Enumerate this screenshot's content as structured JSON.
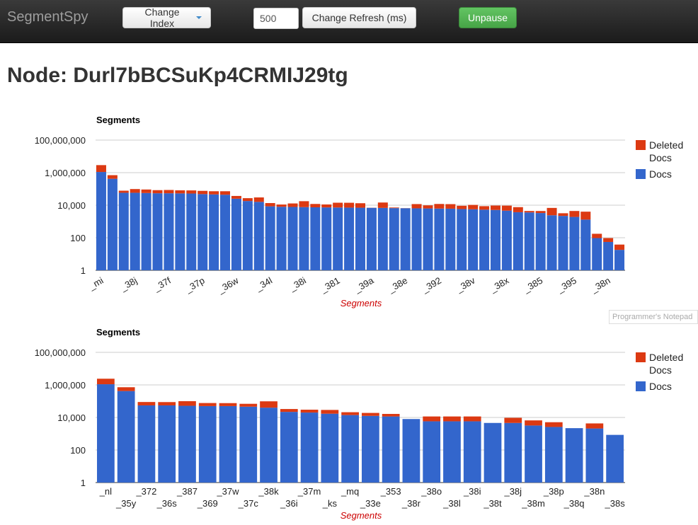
{
  "app": {
    "brand": "SegmentSpy",
    "change_index_label": "Change Index",
    "refresh_value": "500",
    "change_refresh_label": "Change Refresh (ms)",
    "unpause_label": "Unpause"
  },
  "page": {
    "title": "Node: Durl7bBCSuKp4CRMIJ29tg"
  },
  "tooltip": {
    "text": "Programmer's Notepad"
  },
  "colors": {
    "docs": "#3366cc",
    "deleted": "#dc3912",
    "axis_title": "#cc0000"
  },
  "chart_data": [
    {
      "type": "bar",
      "stacked": true,
      "log_scale": true,
      "title": "Segments",
      "xlabel": "Segments",
      "ylabel": "",
      "ylim": [
        1,
        100000000
      ],
      "y_ticks": [
        "1",
        "100",
        "10,000",
        "1,000,000",
        "100,000,000"
      ],
      "legend_position": "right",
      "legend": [
        "Deleted Docs",
        "Docs"
      ],
      "categories": [
        "_mi",
        "",
        "",
        "_38j",
        "",
        "",
        "_37f",
        "",
        "",
        "_37p",
        "",
        "",
        "_36w",
        "",
        "",
        "_34l",
        "",
        "",
        "_38i",
        "",
        "",
        "_381",
        "",
        "",
        "_39a",
        "",
        "",
        "_38e",
        "",
        "",
        "_392",
        "",
        "",
        "_38v",
        "",
        "",
        "_38x",
        "",
        "",
        "_385",
        "",
        "",
        "_395",
        "",
        "",
        "_38n",
        ""
      ],
      "series": [
        {
          "name": "Docs",
          "values": [
            1100000,
            420000,
            58000,
            58000,
            56000,
            54000,
            54000,
            53000,
            52000,
            48000,
            46000,
            44000,
            25000,
            18000,
            16000,
            8500,
            8000,
            7800,
            7600,
            7400,
            7300,
            7200,
            7100,
            7000,
            6900,
            6800,
            6600,
            6500,
            6400,
            6300,
            6200,
            6100,
            5800,
            5600,
            5300,
            5100,
            4600,
            3700,
            3600,
            3300,
            2400,
            2200,
            1900,
            1300,
            95,
            55,
            18
          ]
        },
        {
          "name": "Deleted Docs",
          "values": [
            1800000,
            280000,
            20000,
            40000,
            36000,
            30000,
            32000,
            29000,
            29000,
            28000,
            26000,
            28000,
            12000,
            9000,
            14000,
            5000,
            3000,
            5000,
            10000,
            4500,
            3800,
            7000,
            7000,
            6200,
            100,
            7800,
            600,
            100,
            5300,
            3500,
            5700,
            5500,
            3400,
            4800,
            3400,
            4400,
            4800,
            3900,
            800,
            1100,
            4400,
            1000,
            2500,
            2700,
            80,
            40,
            20
          ]
        }
      ]
    },
    {
      "type": "bar",
      "stacked": true,
      "log_scale": true,
      "title": "Segments",
      "xlabel": "Segments",
      "ylabel": "",
      "ylim": [
        1,
        100000000
      ],
      "y_ticks": [
        "1",
        "100",
        "10,000",
        "1,000,000",
        "100,000,000"
      ],
      "legend_position": "right",
      "legend": [
        "Deleted Docs",
        "Docs"
      ],
      "categories": [
        "_nl",
        "_35y",
        "_372",
        "_36s",
        "_387",
        "_369",
        "_37w",
        "_37c",
        "_38k",
        "_36i",
        "_37m",
        "_ks",
        "_mq",
        "_33e",
        "_353",
        "_38r",
        "_38o",
        "_38l",
        "_38i",
        "_38t",
        "_38j",
        "_38m",
        "_38p",
        "_38q",
        "_38n",
        "_38s"
      ],
      "series": [
        {
          "name": "Docs",
          "values": [
            1100000,
            420000,
            55000,
            55000,
            52000,
            50000,
            50000,
            46000,
            40000,
            22000,
            20000,
            17000,
            14000,
            12500,
            11500,
            8000,
            5800,
            5800,
            5800,
            4600,
            4600,
            3200,
            2600,
            2200,
            2100,
            850
          ]
        },
        {
          "name": "Deleted Docs",
          "values": [
            1300000,
            300000,
            34000,
            33000,
            48000,
            27000,
            26000,
            23000,
            58000,
            11000,
            10000,
            12000,
            7000,
            6500,
            5000,
            0,
            5700,
            5700,
            5700,
            0,
            4900,
            3400,
            2500,
            0,
            2200,
            0
          ]
        }
      ]
    }
  ]
}
